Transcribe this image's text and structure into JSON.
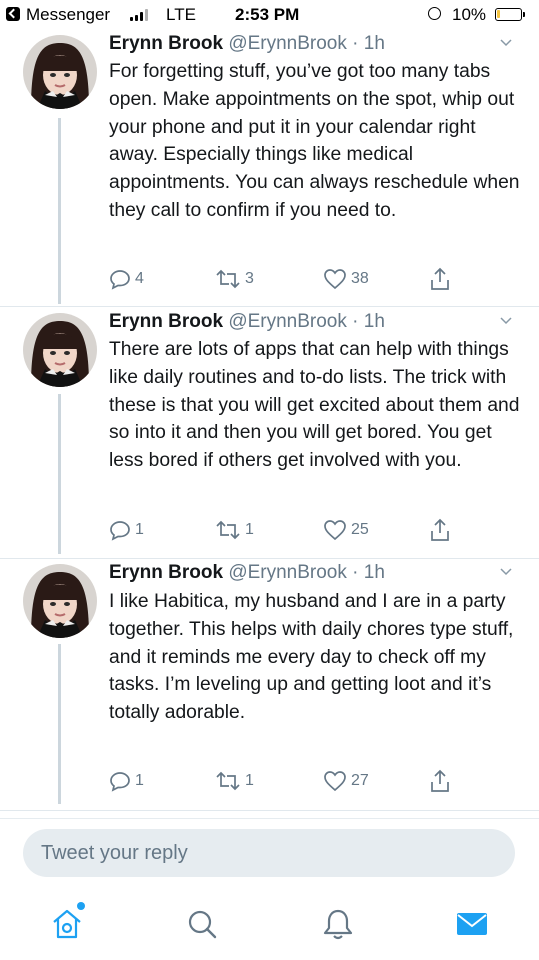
{
  "status_bar": {
    "back_app": "Messenger",
    "network": "LTE",
    "time": "2:53 PM",
    "battery": "10%"
  },
  "tweets": [
    {
      "name": "Erynn Brook",
      "handle": "@ErynnBrook",
      "time": "· 1h",
      "text": "For forgetting stuff, you’ve got too many tabs open. Make appointments on the spot, whip out your phone and put it in your calendar right away. Especially things like medical appointments. You can always reschedule when they call to confirm if you need to.",
      "replies": "4",
      "retweets": "3",
      "likes": "38"
    },
    {
      "name": "Erynn Brook",
      "handle": "@ErynnBrook",
      "time": "· 1h",
      "text": "There are lots of apps that can help with things like daily routines and to-do lists. The trick with these is that you will get excited about them and so into it and then you will get bored. You get less bored if others get involved with you.",
      "replies": "1",
      "retweets": "1",
      "likes": "25"
    },
    {
      "name": "Erynn Brook",
      "handle": "@ErynnBrook",
      "time": "· 1h",
      "text": "I like Habitica, my husband and I are in a party together. This helps with daily chores type stuff, and it reminds me every day to check off my tasks. I’m leveling up and getting loot and it’s totally adorable.",
      "replies": "1",
      "retweets": "1",
      "likes": "27"
    }
  ],
  "reply": {
    "placeholder": "Tweet your reply"
  },
  "nav": {
    "items": [
      "home-icon",
      "search-icon",
      "notifications-icon",
      "messages-icon"
    ],
    "accent_color": "#1da1f2"
  }
}
